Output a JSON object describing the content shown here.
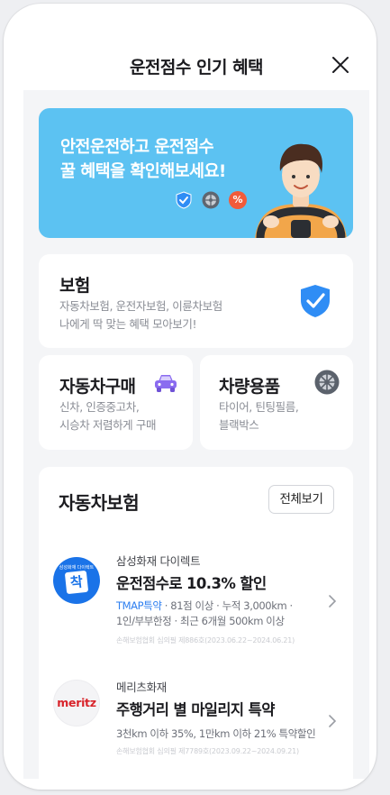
{
  "header": {
    "title": "운전점수 인기 혜택"
  },
  "banner": {
    "line1": "안전운전하고 운전점수",
    "line2": "꿀 혜택을 확인해보세요!",
    "badge_percent": "%",
    "background_color": "#5cc2f2"
  },
  "insurance_card": {
    "title": "보험",
    "desc_line1": "자동차보험, 운전자보험, 이륜차보험",
    "desc_line2": "나에게 딱 맞는 혜택 모아보기!",
    "icon": "shield-check-icon"
  },
  "car_purchase_card": {
    "title": "자동차구매",
    "desc_line1": "신차, 인증중고차,",
    "desc_line2": "시승차 저렴하게 구매",
    "icon": "car-icon"
  },
  "car_accessory_card": {
    "title": "차량용품",
    "desc_line1": "타이어, 틴팅필름,",
    "desc_line2": "블랙박스",
    "icon": "wheel-icon"
  },
  "auto_insurance": {
    "title": "자동차보험",
    "see_all": "전체보기",
    "items": [
      {
        "logo_caption": "삼성화재 다이렉트",
        "logo_mark": "착",
        "company": "삼성화재 다이렉트",
        "headline": "운전점수로 10.3% 할인",
        "tag": "TMAP특약",
        "meta_line1_rest": " · 81점 이상 · 누적 3,000km ·",
        "meta_line2": "1인/부부한정 · 최근 6개월 500km 이상",
        "fine_print": "손해보험협회 심의필 제886호(2023.06.22~2024.06.21)"
      },
      {
        "logo_word": "meritz",
        "company": "메리츠화재",
        "headline": "주행거리 별 마일리지 특약",
        "meta_line1": "3천km 이하 35%, 1만km 이하 21% 특약할인",
        "fine_print": "손해보험협회 심의필 제7789호(2023.09.22~2024.09.21)"
      }
    ]
  },
  "colors": {
    "accent_blue": "#2e7ff0",
    "shield_blue": "#2f8df5",
    "car_purple": "#8b6cf0",
    "meritz_red": "#d8232a"
  }
}
